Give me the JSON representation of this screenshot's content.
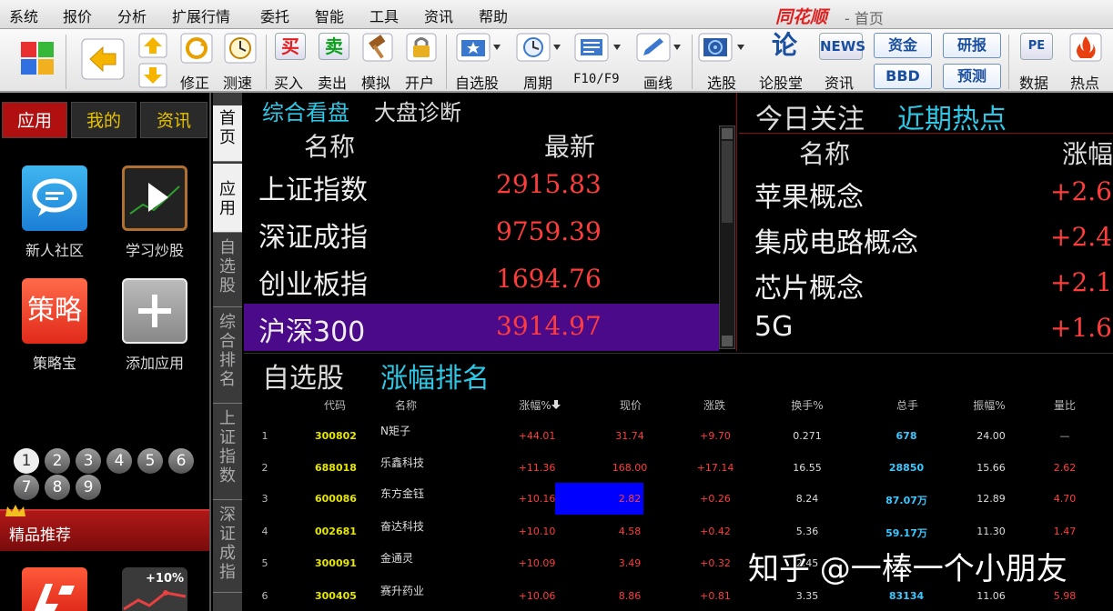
{
  "menu": [
    "系统",
    "报价",
    "分析",
    "扩展行情",
    "委托",
    "智能",
    "工具",
    "资讯",
    "帮助"
  ],
  "brand": {
    "logo_text": "同花顺",
    "subtitle": "- 首页"
  },
  "toolbar": {
    "edit": "修正",
    "speed": "测速",
    "buy": "买入",
    "sell": "卖出",
    "simulate": "模拟",
    "open_account": "开户",
    "watchlist": "自选股",
    "period": "周期",
    "f10": "F10/F9",
    "draw_line": "画线",
    "select_stock": "选股",
    "forum": "论股堂",
    "news": "资讯",
    "funds": "资金",
    "bbd": "BBD",
    "research": "研报",
    "forecast": "预测",
    "data": "数据",
    "hot": "热点",
    "buy_glyph": "买",
    "sell_glyph": "卖",
    "forum_glyph": "论",
    "news_glyph": "NEWS",
    "pe_glyph": "PE"
  },
  "left": {
    "tabs": [
      "应用",
      "我的",
      "资讯"
    ],
    "apps": [
      "新人社区",
      "学习炒股",
      "策略宝",
      "添加应用"
    ],
    "strategy_tile": "策略",
    "pages": [
      "1",
      "2",
      "3",
      "4",
      "5",
      "6",
      "7",
      "8",
      "9"
    ],
    "featured": "精品推荐",
    "promo_badge": "+10%"
  },
  "vtabs": [
    "首页",
    "应用",
    "自选股",
    "综合排名",
    "上证指数",
    "深证成指"
  ],
  "market": {
    "tab_active": "综合看盘",
    "tab_other": "大盘诊断",
    "col_name": "名称",
    "col_latest": "最新",
    "rows": [
      {
        "name": "上证指数",
        "value": "2915.83"
      },
      {
        "name": "深证成指",
        "value": "9759.39"
      },
      {
        "name": "创业板指",
        "value": "1694.76"
      },
      {
        "name": "沪深300",
        "value": "3914.97"
      }
    ]
  },
  "hot": {
    "tab_active": "今日关注",
    "tab_other": "近期热点",
    "col_name": "名称",
    "col_change": "涨幅",
    "rows": [
      {
        "name": "苹果概念",
        "value": "+2.6"
      },
      {
        "name": "集成电路概念",
        "value": "+2.4"
      },
      {
        "name": "芯片概念",
        "value": "+2.1"
      },
      {
        "name": "5G",
        "value": "+1.6"
      }
    ]
  },
  "ranking": {
    "tab_inactive": "自选股",
    "tab_active": "涨幅排名",
    "headers": [
      "代码",
      "名称",
      "涨幅%",
      "现价",
      "涨跌",
      "换手%",
      "总手",
      "振幅%",
      "量比"
    ],
    "rows": [
      [
        "1",
        "300802",
        "N矩子",
        "+44.01",
        "31.74",
        "+9.70",
        "0.271",
        "678",
        "24.00",
        "—"
      ],
      [
        "2",
        "688018",
        "乐鑫科技",
        "+11.36",
        "168.00",
        "+17.14",
        "16.55",
        "28850",
        "15.66",
        "2.62"
      ],
      [
        "3",
        "600086",
        "东方金钰",
        "+10.16",
        "2.82",
        "+0.26",
        "8.24",
        "87.07万",
        "12.89",
        "4.70"
      ],
      [
        "4",
        "002681",
        "奋达科技",
        "+10.10",
        "4.58",
        "+0.42",
        "5.36",
        "59.17万",
        "11.30",
        "1.47"
      ],
      [
        "5",
        "300091",
        "金通灵",
        "+10.09",
        "3.49",
        "+0.32",
        "2.45",
        "",
        "",
        ""
      ],
      [
        "6",
        "300405",
        "赛升药业",
        "+10.06",
        "8.86",
        "+0.81",
        "3.35",
        "83134",
        "11.06",
        "5.98"
      ]
    ]
  },
  "watermark": "知乎 @一棒一个小朋友",
  "colors": {
    "up": "#ff3c3c",
    "cyan": "#2ec8e6",
    "highlight_row": "#4b0a8a",
    "selected_cell": "#0000ff",
    "code_yellow": "#e6e600",
    "volume_cyan": "#3cc8ff"
  }
}
